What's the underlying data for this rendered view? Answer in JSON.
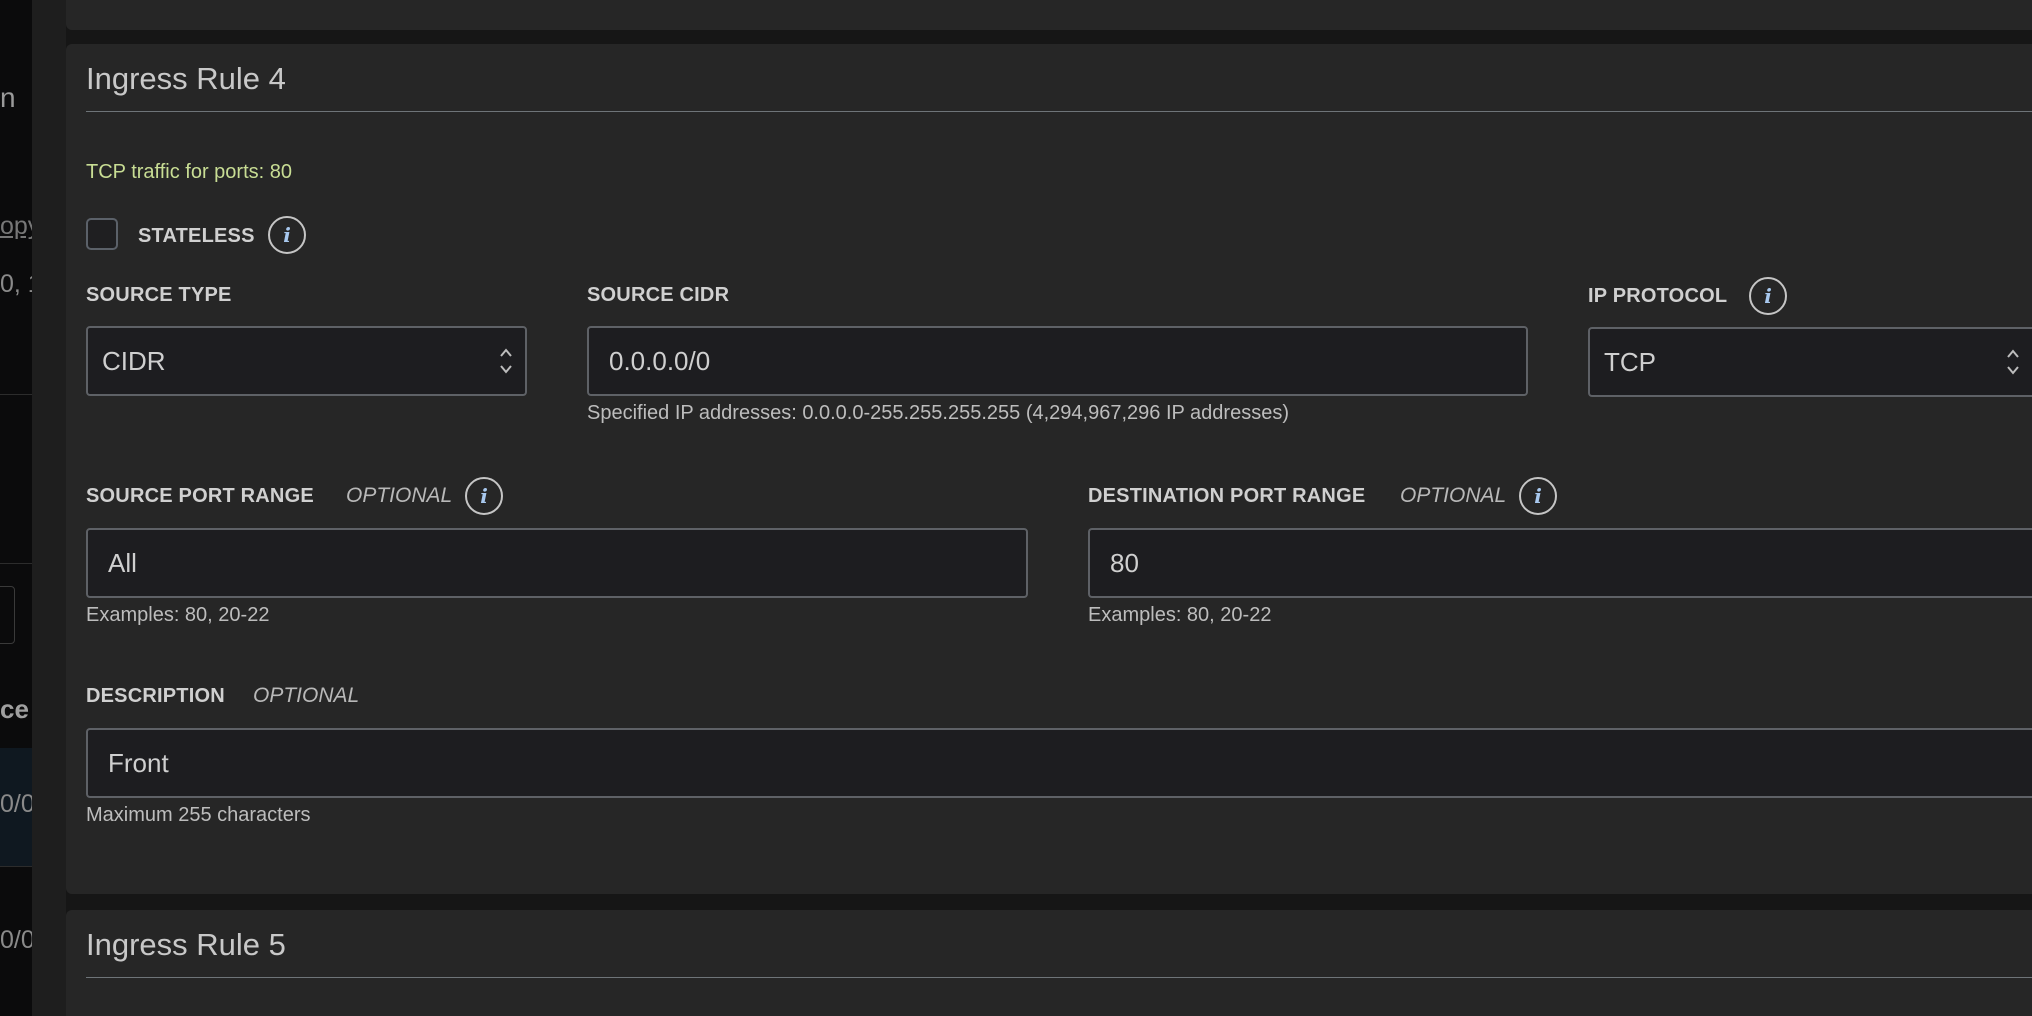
{
  "background": {
    "fragments": [
      "n",
      "opy",
      "0, 1",
      "ce",
      "0/0",
      "0/0"
    ]
  },
  "rule4": {
    "title": "Ingress Rule 4",
    "summary": "TCP traffic for ports: 80",
    "stateless_label": "STATELESS",
    "source_type": {
      "label": "SOURCE TYPE",
      "value": "CIDR"
    },
    "source_cidr": {
      "label": "SOURCE CIDR",
      "value": "0.0.0.0/0",
      "help": "Specified IP addresses: 0.0.0.0-255.255.255.255 (4,294,967,296 IP addresses)"
    },
    "ip_protocol": {
      "label": "IP PROTOCOL",
      "value": "TCP"
    },
    "source_port_range": {
      "label": "SOURCE PORT RANGE",
      "optional": "OPTIONAL",
      "value": "All",
      "help": "Examples: 80, 20-22"
    },
    "destination_port_range": {
      "label": "DESTINATION PORT RANGE",
      "optional": "OPTIONAL",
      "value": "80",
      "help": "Examples: 80, 20-22"
    },
    "description": {
      "label": "DESCRIPTION",
      "optional": "OPTIONAL",
      "value": "Front",
      "help": "Maximum 255 characters"
    },
    "info_glyph": "i"
  },
  "rule5": {
    "title": "Ingress Rule 5"
  },
  "colors": {
    "summary_text": "#c8dd94",
    "info_icon": "#a8c8ee",
    "card_bg": "#262626",
    "field_bg": "#1d1d20"
  }
}
